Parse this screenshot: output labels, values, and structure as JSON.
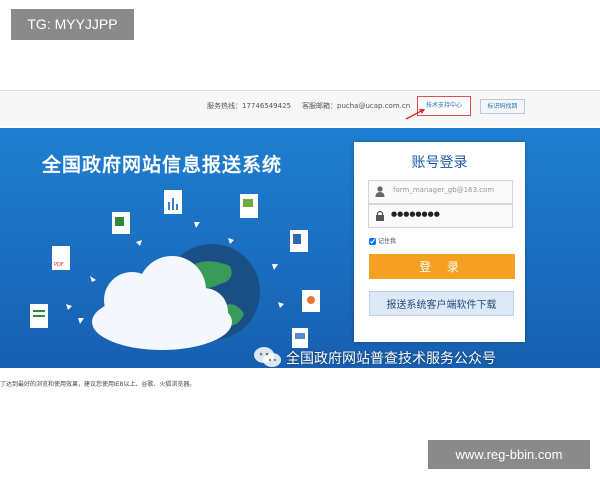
{
  "watermarks": {
    "top_left": "TG: MYYJJPP",
    "bottom_right": "www.reg-bbin.com"
  },
  "topbar": {
    "hotline": "服务热线：17746549425",
    "email": "客服邮箱：pucha@ucap.com.cn",
    "support_button": "技术支持中心",
    "password_button": "标识码找回"
  },
  "banner": {
    "title": "全国政府网站信息报送系统"
  },
  "login": {
    "title": "账号登录",
    "username_placeholder": "form_manager_gb@163.com",
    "password_value": "●●●●●●●●",
    "remember_label": "记住我",
    "remember_checked": true,
    "login_button": "登 录",
    "download_button": "报送系统客户端软件下载"
  },
  "wechat_caption": "全国政府网站普查技术服务公众号",
  "footnote": "了达到最好的浏览和使用效果，建议您使用IE8以上、谷歌、火狐浏览器。",
  "colors": {
    "banner_blue": "#1a6cbf",
    "login_orange": "#f5a020",
    "title_blue": "#1e5aa8"
  },
  "icons": [
    "user-icon",
    "lock-icon",
    "cloud-icon",
    "globe-icon",
    "excel-file-icon",
    "pdf-file-icon",
    "wechat-icon"
  ]
}
